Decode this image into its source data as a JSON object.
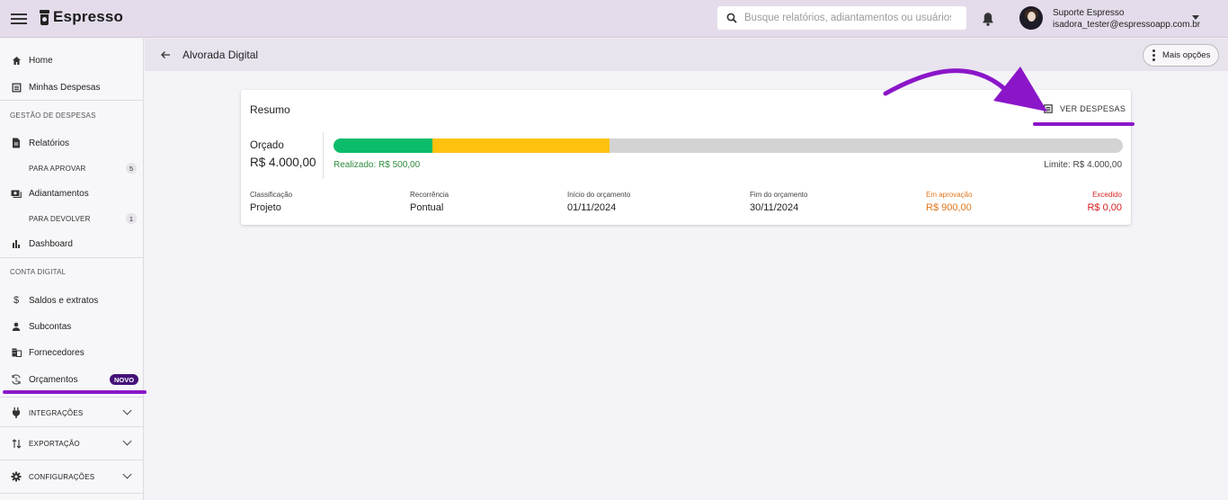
{
  "app": {
    "name": "Espresso"
  },
  "search": {
    "placeholder": "Busque relatórios, adiantamentos ou usuários"
  },
  "user": {
    "name": "Suporte Espresso",
    "email": "isadora_tester@espressoapp.com.br"
  },
  "sidebar": {
    "home": "Home",
    "minhas_despesas": "Minhas Despesas",
    "section_gestao": "GESTÃO DE DESPESAS",
    "relatorios": "Relatórios",
    "para_aprovar": "PARA APROVAR",
    "para_aprovar_count": "5",
    "adiantamentos": "Adiantamentos",
    "para_devolver": "PARA DEVOLVER",
    "para_devolver_count": "1",
    "dashboard": "Dashboard",
    "section_conta": "CONTA DIGITAL",
    "saldos": "Saldos e extratos",
    "subcontas": "Subcontas",
    "fornecedores": "Fornecedores",
    "orcamentos": "Orçamentos",
    "novo_badge": "NOVO",
    "integracoes": "INTEGRAÇÕES",
    "exportacao": "EXPORTAÇÃO",
    "configuracoes": "CONFIGURAÇÕES"
  },
  "page": {
    "title": "Alvorada Digital",
    "more_options": "Mais opções"
  },
  "summary": {
    "title": "Resumo",
    "ver_despesas": "VER DESPESAS",
    "orcado_label": "Orçado",
    "orcado_value": "R$ 4.000,00",
    "realizado": "Realizado: R$ 500,00",
    "limite": "Limite: R$ 4.000,00",
    "progress": {
      "realizado_fraction": 0.125,
      "em_aprovacao_fraction": 0.225
    },
    "colors": {
      "realizado": "#0bbd6b",
      "em_aprovacao": "#ffc20e",
      "remaining": "#d3d3d3",
      "annotation": "#8b16c9",
      "orange": "#e2761b",
      "red": "#d62020"
    },
    "fields": {
      "classificacao": {
        "label": "Classificação",
        "value": "Projeto"
      },
      "recorrencia": {
        "label": "Recorrência",
        "value": "Pontual"
      },
      "inicio": {
        "label": "Início do orçamento",
        "value": "01/11/2024"
      },
      "fim": {
        "label": "Fim do orçamento",
        "value": "30/11/2024"
      },
      "em_aprovacao": {
        "label": "Em aprovação",
        "value": "R$ 900,00"
      },
      "excedido": {
        "label": "Excedido",
        "value": "R$ 0,00"
      }
    }
  }
}
